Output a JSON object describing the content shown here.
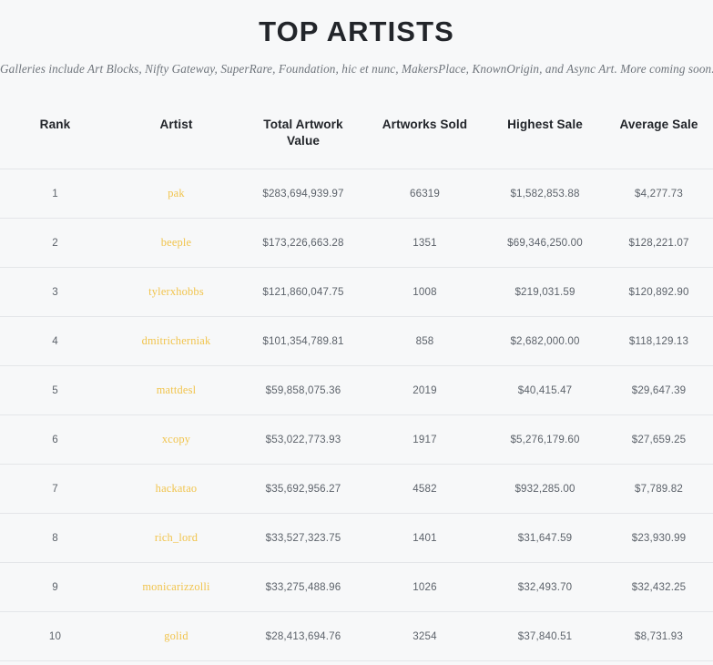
{
  "header": {
    "title": "TOP ARTISTS",
    "subtitle": "Galleries include Art Blocks, Nifty Gateway, SuperRare, Foundation, hic et nunc, MakersPlace, KnownOrigin, and Async Art. More coming soon."
  },
  "colors": {
    "page_background": "#f7f8f9",
    "title_text": "#22252a",
    "subtitle_text": "#6f757c",
    "artist_link": "#f1c44d",
    "cell_text": "#5d636b",
    "row_divider": "#e4e6e9"
  },
  "table": {
    "columns": [
      {
        "key": "rank",
        "label": "Rank"
      },
      {
        "key": "artist",
        "label": "Artist"
      },
      {
        "key": "total",
        "label": "Total Artwork Value"
      },
      {
        "key": "sold",
        "label": "Artworks Sold"
      },
      {
        "key": "highest",
        "label": "Highest Sale"
      },
      {
        "key": "average",
        "label": "Average Sale"
      }
    ],
    "rows": [
      {
        "rank": "1",
        "artist": "pak",
        "total": "$283,694,939.97",
        "sold": "66319",
        "highest": "$1,582,853.88",
        "average": "$4,277.73"
      },
      {
        "rank": "2",
        "artist": "beeple",
        "total": "$173,226,663.28",
        "sold": "1351",
        "highest": "$69,346,250.00",
        "average": "$128,221.07"
      },
      {
        "rank": "3",
        "artist": "tylerxhobbs",
        "total": "$121,860,047.75",
        "sold": "1008",
        "highest": "$219,031.59",
        "average": "$120,892.90"
      },
      {
        "rank": "4",
        "artist": "dmitricherniak",
        "total": "$101,354,789.81",
        "sold": "858",
        "highest": "$2,682,000.00",
        "average": "$118,129.13"
      },
      {
        "rank": "5",
        "artist": "mattdesl",
        "total": "$59,858,075.36",
        "sold": "2019",
        "highest": "$40,415.47",
        "average": "$29,647.39"
      },
      {
        "rank": "6",
        "artist": "xcopy",
        "total": "$53,022,773.93",
        "sold": "1917",
        "highest": "$5,276,179.60",
        "average": "$27,659.25"
      },
      {
        "rank": "7",
        "artist": "hackatao",
        "total": "$35,692,956.27",
        "sold": "4582",
        "highest": "$932,285.00",
        "average": "$7,789.82"
      },
      {
        "rank": "8",
        "artist": "rich_lord",
        "total": "$33,527,323.75",
        "sold": "1401",
        "highest": "$31,647.59",
        "average": "$23,930.99"
      },
      {
        "rank": "9",
        "artist": "monicarizzolli",
        "total": "$33,275,488.96",
        "sold": "1026",
        "highest": "$32,493.70",
        "average": "$32,432.25"
      },
      {
        "rank": "10",
        "artist": "golid",
        "total": "$28,413,694.76",
        "sold": "3254",
        "highest": "$37,840.51",
        "average": "$8,731.93"
      }
    ]
  }
}
